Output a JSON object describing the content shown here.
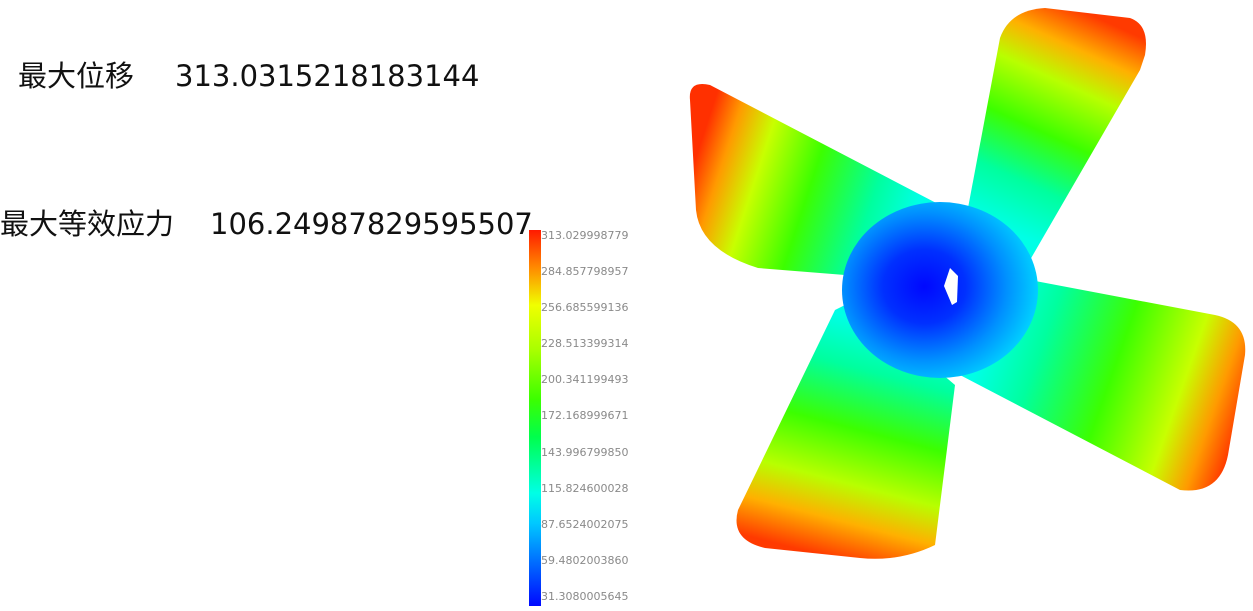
{
  "stats": {
    "max_displacement_label": "最大位移",
    "max_displacement_value": "313.0315218183144",
    "max_stress_label": "最大等效应力",
    "max_stress_value": "106.24987829595507"
  },
  "color_legend": {
    "ticks": [
      "313.029998779",
      "284.857798957",
      "256.685599136",
      "228.513399314",
      "200.341199493",
      "172.168999671",
      "143.996799850",
      "115.824600028",
      "87.6524002075",
      "59.4802003860",
      "31.3080005645"
    ],
    "colors": {
      "max": "#ff1a00",
      "high": "#ff8a00",
      "mid_high": "#f0ff00",
      "mid": "#3cff00",
      "mid_low": "#00ffe6",
      "low": "#0008ff"
    }
  }
}
